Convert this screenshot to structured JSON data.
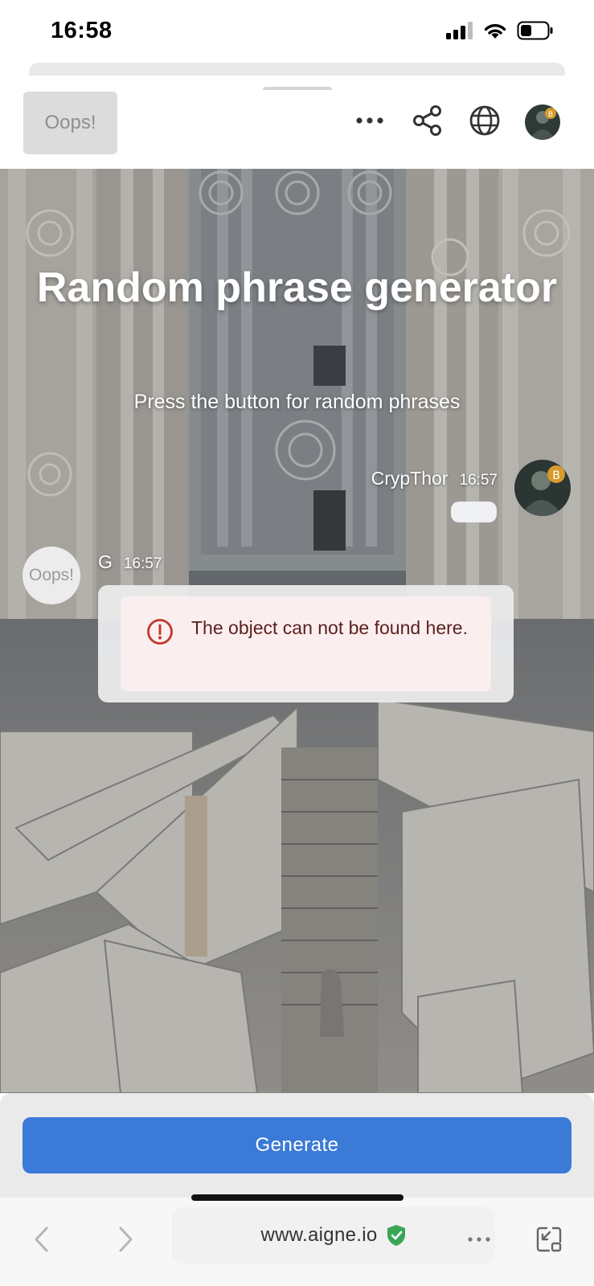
{
  "status_bar": {
    "time": "16:58"
  },
  "header": {
    "logo_text": "Oops!",
    "icons": [
      "more-icon",
      "share-icon",
      "globe-icon",
      "avatar"
    ]
  },
  "hero": {
    "title": "Random phrase generator",
    "subtitle": "Press the button for random phrases"
  },
  "chat": {
    "user_message": {
      "name": "CrypThor",
      "time": "16:57"
    },
    "bot_message": {
      "avatar_text": "Oops!",
      "name": "G",
      "time": "16:57",
      "error_text": "The object can not be found here."
    }
  },
  "footer": {
    "generate_label": "Generate"
  },
  "browser": {
    "url": "www.aigne.io",
    "icons": [
      "back-icon",
      "forward-icon",
      "verified-icon",
      "more-icon",
      "minimize-icon"
    ]
  },
  "colors": {
    "accent": "#3b7ad6",
    "error_bg": "#fbeeee",
    "error_icon": "#c0392b",
    "verified": "#3aa655"
  }
}
